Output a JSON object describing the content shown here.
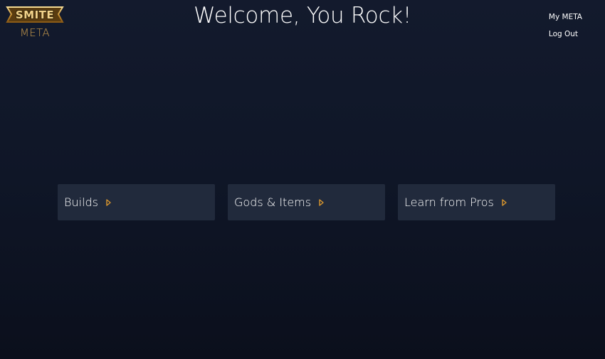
{
  "logo": {
    "badge_text": "SMITE",
    "subtitle": "META"
  },
  "header": {
    "title": "Welcome, You Rock!"
  },
  "nav": {
    "items": [
      {
        "label": "My META"
      },
      {
        "label": "Log Out"
      }
    ]
  },
  "cards": [
    {
      "label": "Builds",
      "icon": "play-triangle-outline-icon"
    },
    {
      "label": "Gods & Items",
      "icon": "play-triangle-outline-icon"
    },
    {
      "label": "Learn from Pros",
      "icon": "play-triangle-outline-icon"
    }
  ],
  "colors": {
    "background": "#111829",
    "card": "#212a3c",
    "accent": "#d9962e",
    "logo_gold": "#c99b4c"
  }
}
